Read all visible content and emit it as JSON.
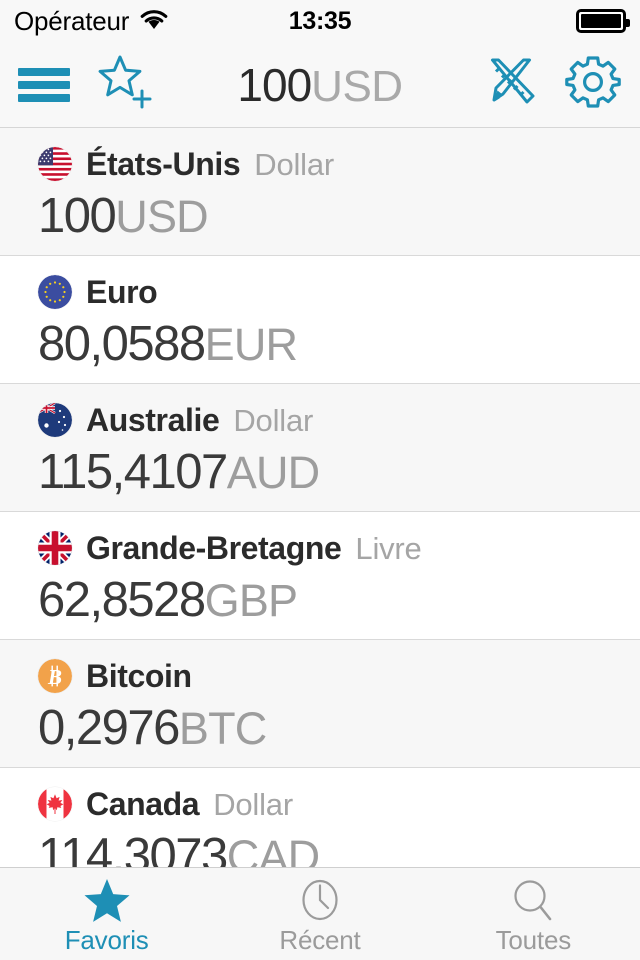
{
  "theme": {
    "accent": "#1e8fb5",
    "muted_text": "#a5a5a5",
    "primary_text": "#2b2b2b",
    "row_alt_bg": "#f7f7f7",
    "row_bg": "#ffffff",
    "bar_bg": "#f8f8f8",
    "separator": "#d9d9d9"
  },
  "status_bar": {
    "carrier": "Opérateur",
    "wifi_icon": "wifi-icon",
    "time": "13:35",
    "battery_icon": "battery-full-icon",
    "battery_level": 100
  },
  "nav_bar": {
    "menu_icon": "hamburger-menu-icon",
    "add_favorite_icon": "star-plus-icon",
    "title": {
      "amount": "100",
      "currency": "USD"
    },
    "converter_icon": "ruler-pencil-icon",
    "settings_icon": "gear-icon"
  },
  "list": {
    "rows": [
      {
        "flag": "flag-us-icon",
        "country": "États-Unis",
        "currency_type": "Dollar",
        "value": "100",
        "code": "USD"
      },
      {
        "flag": "flag-eu-icon",
        "country": "Euro",
        "currency_type": "",
        "value": "80,0588",
        "code": "EUR"
      },
      {
        "flag": "flag-au-icon",
        "country": "Australie",
        "currency_type": "Dollar",
        "value": "115,4107",
        "code": "AUD"
      },
      {
        "flag": "flag-gb-icon",
        "country": "Grande-Bretagne",
        "currency_type": "Livre",
        "value": "62,8528",
        "code": "GBP"
      },
      {
        "flag": "bitcoin-icon",
        "country": "Bitcoin",
        "currency_type": "",
        "value": "0,2976",
        "code": "BTC"
      },
      {
        "flag": "flag-ca-icon",
        "country": "Canada",
        "currency_type": "Dollar",
        "value": "114,3073",
        "code": "CAD"
      }
    ]
  },
  "tab_bar": {
    "tabs": [
      {
        "icon": "star-filled-icon",
        "label": "Favoris",
        "active": true
      },
      {
        "icon": "clock-icon",
        "label": "Récent",
        "active": false
      },
      {
        "icon": "magnifier-icon",
        "label": "Toutes",
        "active": false
      }
    ]
  }
}
